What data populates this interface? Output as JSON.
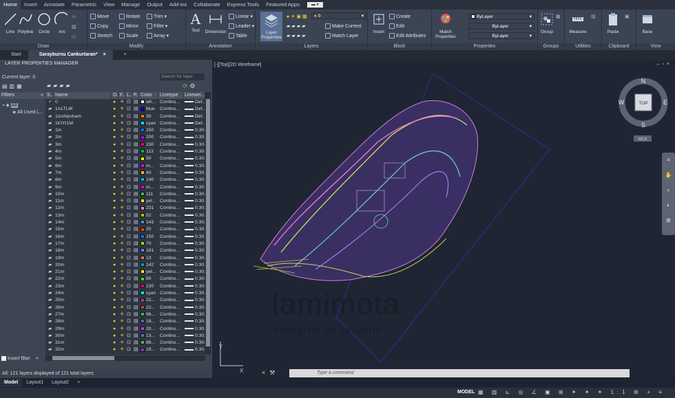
{
  "ribbon_tabs": [
    "Home",
    "Insert",
    "Annotate",
    "Parametric",
    "View",
    "Manage",
    "Output",
    "Add-ins",
    "Collaborate",
    "Express Tools",
    "Featured Apps"
  ],
  "panels": {
    "draw": "Draw",
    "modify": "Modify",
    "annotation": "Annotation",
    "layers": "Layers",
    "block": "Block",
    "properties": "Properties",
    "groups": "Groups",
    "utilities": "Utilities",
    "clipboard": "Clipboard",
    "view": "View"
  },
  "draw_tools": [
    "Line",
    "Polyline",
    "Circle",
    "Arc"
  ],
  "modify_tools": [
    "Move",
    "Rotate",
    "Trim",
    "Copy",
    "Mirror",
    "Fillet",
    "Stretch",
    "Scale",
    "Array"
  ],
  "annotation_tools": {
    "text": "Text",
    "dimension": "Dimension",
    "linear": "Linear",
    "leader": "Leader",
    "table": "Table"
  },
  "layer_tools": {
    "layer_properties": "Layer Properties",
    "current_layer": "0",
    "make_current": "Make Current",
    "match_layer": "Match Layer"
  },
  "block_tools": {
    "insert": "Insert",
    "create": "Create",
    "edit": "Edit",
    "edit_attributes": "Edit Attributes"
  },
  "property_tools": {
    "match": "Match Properties",
    "color": "ByLayer",
    "linetype": "ByLayer",
    "lineweight": "ByLayer"
  },
  "other_tools": {
    "group": "Group",
    "measure": "Measure",
    "paste": "Paste",
    "base": "Base"
  },
  "doc_tabs": {
    "start": "Start",
    "current": "Sarayburnu Cankurtaran*"
  },
  "lpm": {
    "title": "LAYER PROPERTIES MANAGER",
    "current_layer": "Current layer: 0",
    "search_placeholder": "Search for layer",
    "filters_header": "Filters",
    "filter_all": "All",
    "filter_used": "All Used L...",
    "invert_filter": "Invert filter",
    "status": "All: 121 layers displayed of 121 total layers"
  },
  "columns": {
    "s": "S..",
    "name": "Name",
    "o": "O..",
    "f": "F..",
    "l": "L..",
    "p": "P..",
    "color": "Color",
    "linetype": "Linetype",
    "lineweight": "Linewei..."
  },
  "layers": [
    {
      "name": "0",
      "color": "wh...",
      "hex": "#ffffff",
      "lt": "Continu...",
      "lw": "Def..."
    },
    {
      "name": "1ALTLIK",
      "color": "blue",
      "hex": "#0000ff",
      "lt": "Continu...",
      "lw": "Def..."
    },
    {
      "name": "1izohipsham",
      "color": "30",
      "hex": "#ff7f00",
      "lt": "Continu...",
      "lw": "Def..."
    },
    {
      "name": "1KIYI1M",
      "color": "cyan",
      "hex": "#00ffff",
      "lt": "Continu...",
      "lw": "Def..."
    },
    {
      "name": "1m",
      "color": "150",
      "hex": "#007fff",
      "lt": "Continu...",
      "lw": "0.30..."
    },
    {
      "name": "2m",
      "color": "200",
      "hex": "#bf00ff",
      "lt": "Continu...",
      "lw": "0.30..."
    },
    {
      "name": "3m",
      "color": "230",
      "hex": "#ff0080",
      "lt": "Continu...",
      "lw": "0.30..."
    },
    {
      "name": "4m",
      "color": "113",
      "hex": "#00bf3f",
      "lt": "Continu...",
      "lw": "0.30..."
    },
    {
      "name": "5m",
      "color": "50",
      "hex": "#ffff00",
      "lt": "Continu...",
      "lw": "0.30..."
    },
    {
      "name": "6m",
      "color": "m...",
      "hex": "#ff00ff",
      "lt": "Continu...",
      "lw": "0.30..."
    },
    {
      "name": "7m",
      "color": "40",
      "hex": "#ffbf00",
      "lt": "Continu...",
      "lw": "0.30..."
    },
    {
      "name": "8m",
      "color": "140",
      "hex": "#00bfff",
      "lt": "Continu...",
      "lw": "0.30..."
    },
    {
      "name": "9m",
      "color": "m...",
      "hex": "#ff00ff",
      "lt": "Continu...",
      "lw": "0.30..."
    },
    {
      "name": "10m",
      "color": "111",
      "hex": "#3fbf3f",
      "lt": "Continu...",
      "lw": "0.30..."
    },
    {
      "name": "11m",
      "color": "yel...",
      "hex": "#ffff00",
      "lt": "Continu...",
      "lw": "0.30..."
    },
    {
      "name": "12m",
      "color": "231",
      "hex": "#ff7fbf",
      "lt": "Continu...",
      "lw": "0.30..."
    },
    {
      "name": "13m",
      "color": "52",
      "hex": "#bfbf00",
      "lt": "Continu...",
      "lw": "0.30..."
    },
    {
      "name": "14m",
      "color": "143",
      "hex": "#3f9fbf",
      "lt": "Continu...",
      "lw": "0.30..."
    },
    {
      "name": "15m",
      "color": "20",
      "hex": "#ff3f00",
      "lt": "Continu...",
      "lw": "0.30..."
    },
    {
      "name": "16m",
      "color": "150",
      "hex": "#007fff",
      "lt": "Continu...",
      "lw": "0.30..."
    },
    {
      "name": "17m",
      "color": "70",
      "hex": "#7fff00",
      "lt": "Continu...",
      "lw": "0.30..."
    },
    {
      "name": "18m",
      "color": "181",
      "hex": "#7f7fff",
      "lt": "Continu...",
      "lw": "0.30..."
    },
    {
      "name": "19m",
      "color": "13",
      "hex": "#bf7f7f",
      "lt": "Continu...",
      "lw": "0.30..."
    },
    {
      "name": "20m",
      "color": "142",
      "hex": "#00a5bf",
      "lt": "Continu...",
      "lw": "0.30..."
    },
    {
      "name": "21m",
      "color": "yel...",
      "hex": "#ffff00",
      "lt": "Continu...",
      "lw": "0.30..."
    },
    {
      "name": "22m",
      "color": "80",
      "hex": "#3fff00",
      "lt": "Continu...",
      "lw": "0.30..."
    },
    {
      "name": "23m",
      "color": "230",
      "hex": "#ff0080",
      "lt": "Continu...",
      "lw": "0.30..."
    },
    {
      "name": "24m",
      "color": "cyan",
      "hex": "#00ffff",
      "lt": "Continu...",
      "lw": "0.30..."
    },
    {
      "name": "25m",
      "color": "22...",
      "hex": "#bf3f7f",
      "lt": "Continu...",
      "lw": "0.30..."
    },
    {
      "name": "26m",
      "color": "22...",
      "hex": "#bf3f5f",
      "lt": "Continu...",
      "lw": "0.30..."
    },
    {
      "name": "27m",
      "color": "96...",
      "hex": "#3fbf5f",
      "lt": "Continu...",
      "lw": "0.30..."
    },
    {
      "name": "28m",
      "color": "18...",
      "hex": "#5f5fbf",
      "lt": "Continu...",
      "lw": "0.30..."
    },
    {
      "name": "29m",
      "color": "20...",
      "hex": "#bf3fff",
      "lt": "Continu...",
      "lw": "0.30..."
    },
    {
      "name": "30m",
      "color": "13...",
      "hex": "#3f7fbf",
      "lt": "Continu...",
      "lw": "0.30..."
    },
    {
      "name": "31m",
      "color": "86...",
      "hex": "#5fbf3f",
      "lt": "Continu...",
      "lw": "0.30..."
    },
    {
      "name": "32m",
      "color": "19...",
      "hex": "#7f3fbf",
      "lt": "Continu...",
      "lw": "0.30..."
    }
  ],
  "viewport": {
    "label": "[-][Top][2D Wireframe]",
    "compass": {
      "n": "N",
      "s": "S",
      "e": "E",
      "w": "W",
      "top": "TOP",
      "wcs": "WCS"
    },
    "watermark": "lamimota",
    "watermark_sub": "mimarlık ve tasarım",
    "ucs_y": "Y",
    "ucs_x": "X"
  },
  "command": {
    "placeholder": "Type a command"
  },
  "layout_tabs": [
    "Model",
    "Layout1",
    "Layout2"
  ],
  "status_model": "MODEL",
  "status_scale": "1:1"
}
